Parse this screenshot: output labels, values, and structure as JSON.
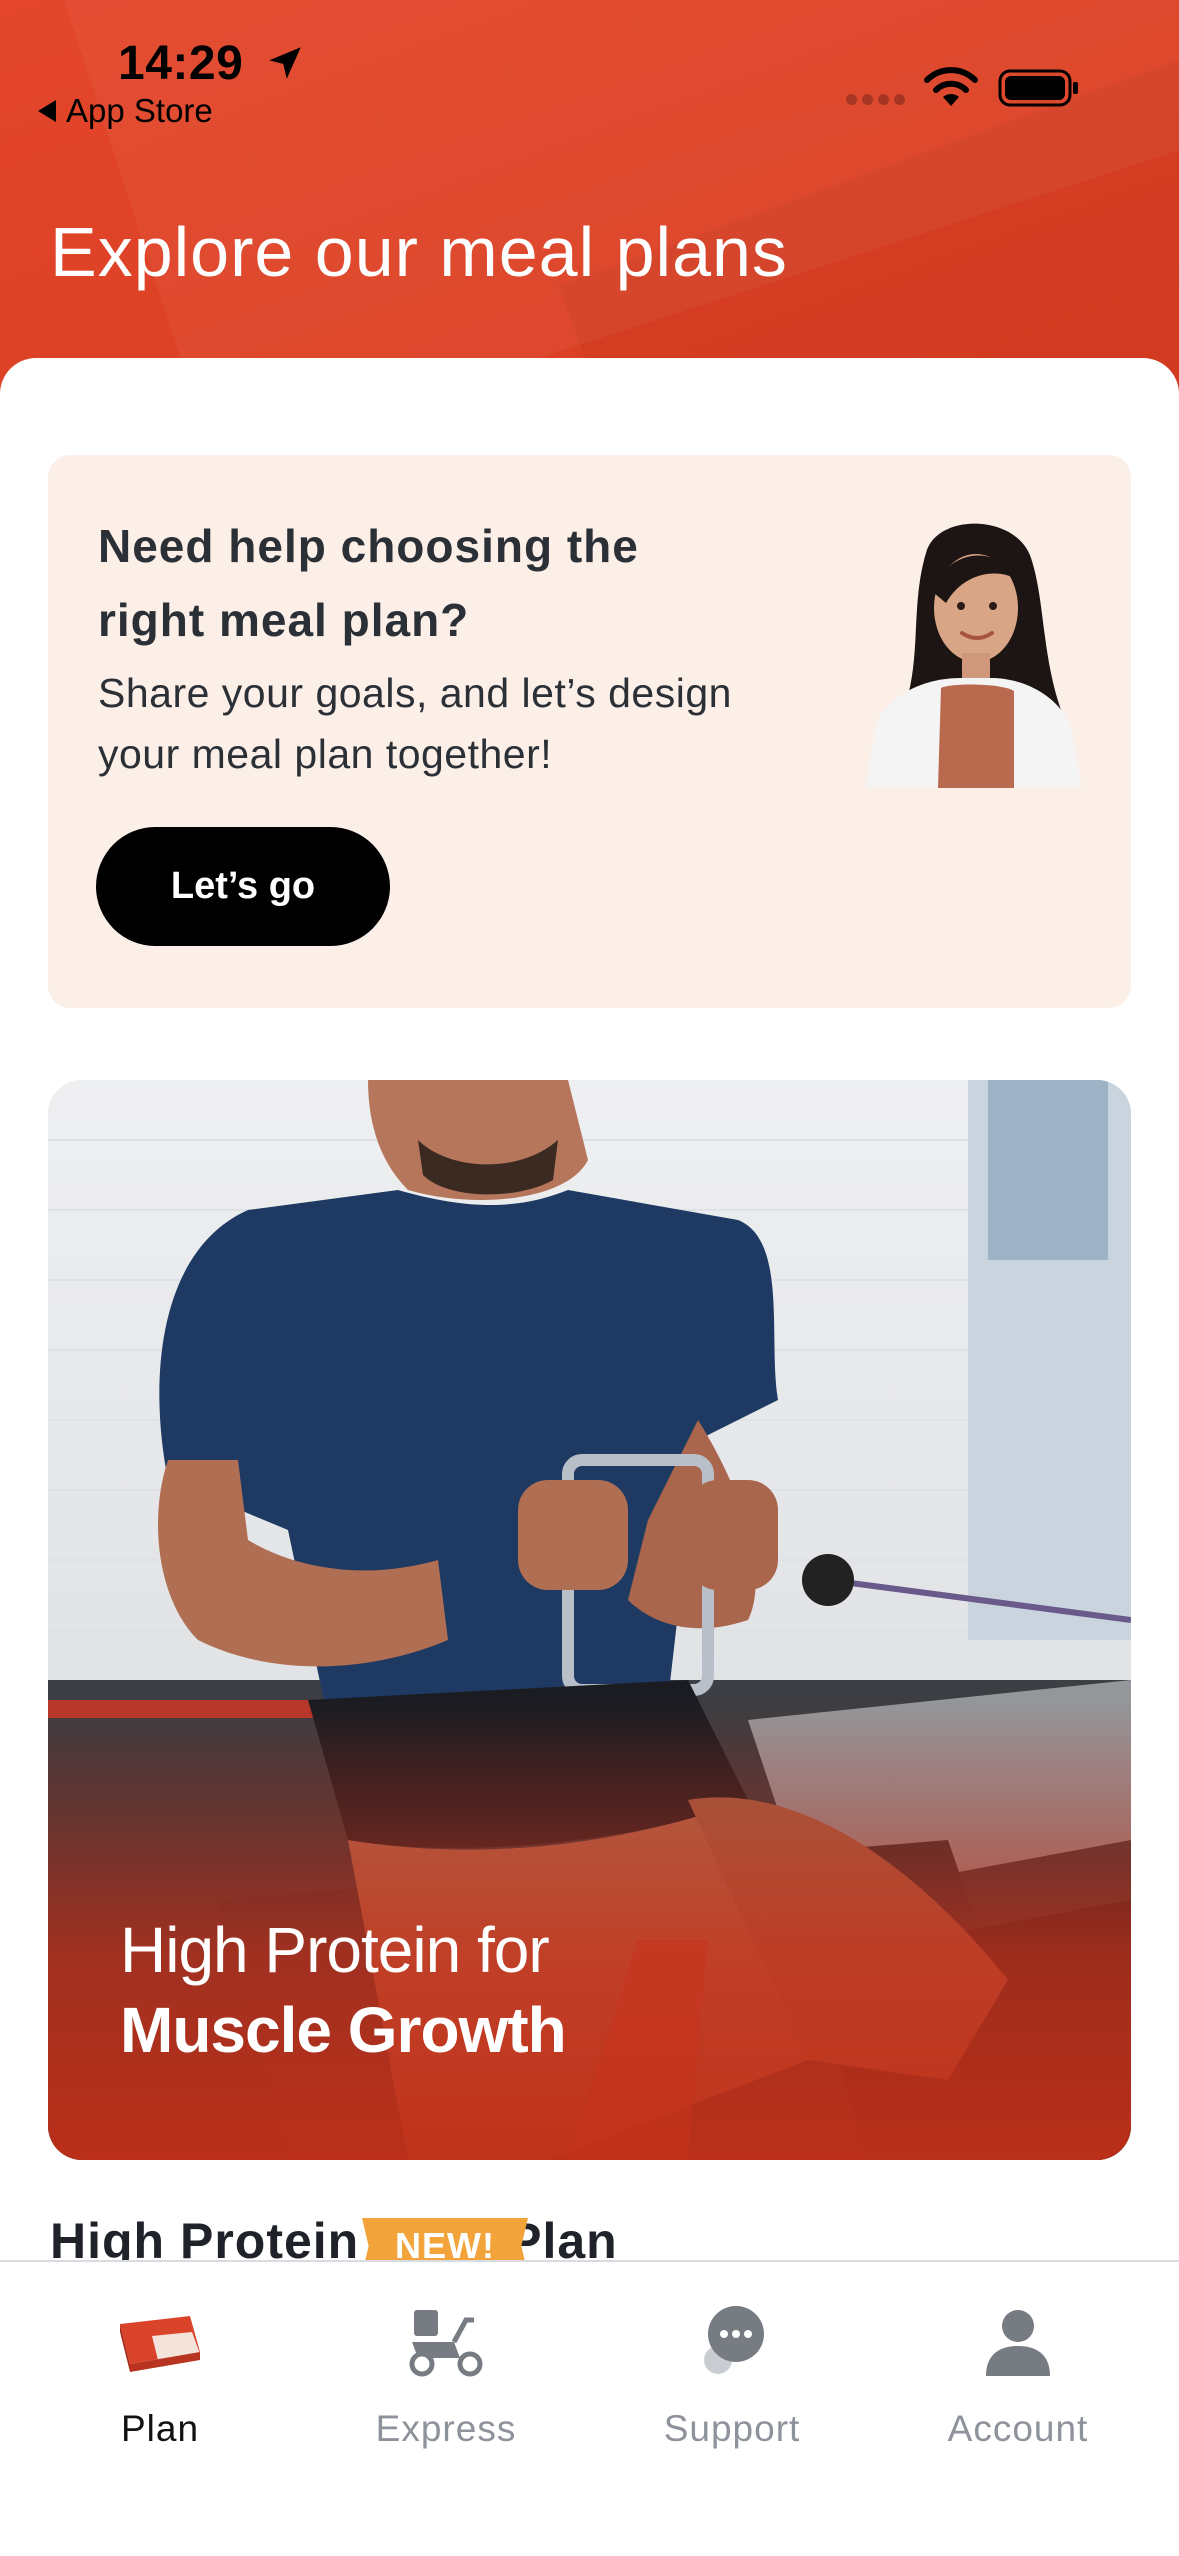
{
  "status_bar": {
    "time": "14:29",
    "back_label": "App Store"
  },
  "header": {
    "title": "Explore our meal plans",
    "color": "#df4327"
  },
  "help_card": {
    "title": "Need help choosing the right meal plan?",
    "subtitle": "Share your goals, and let’s design your meal plan together!",
    "button_label": "Let’s go",
    "background": "#fcefe8"
  },
  "promo_card": {
    "line1": "High Protein for",
    "line2": "Muscle Growth",
    "accent": "#c8321b"
  },
  "section": {
    "title": "High Protein          Plan",
    "badge": "NEW!",
    "badge_color": "#f2a33a"
  },
  "tabbar": {
    "tabs": [
      {
        "label": "Plan",
        "icon": "meal-box-icon",
        "active": true
      },
      {
        "label": "Express",
        "icon": "scooter-icon",
        "active": false
      },
      {
        "label": "Support",
        "icon": "chat-bubbles-icon",
        "active": false
      },
      {
        "label": "Account",
        "icon": "person-icon",
        "active": false
      }
    ]
  }
}
